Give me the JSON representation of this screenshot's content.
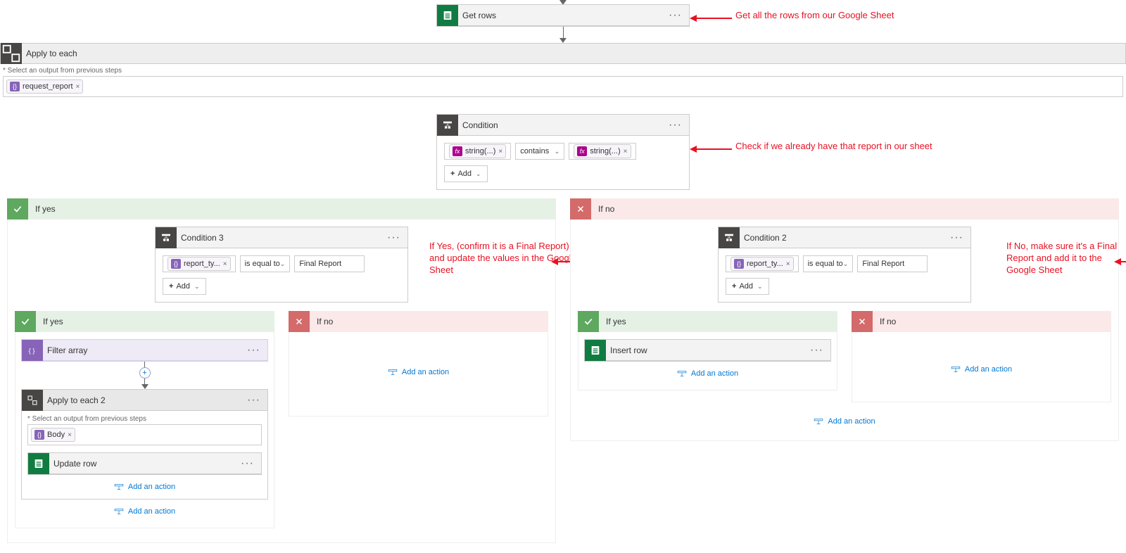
{
  "steps": {
    "getRows": {
      "title": "Get rows"
    },
    "applyEach": {
      "title": "Apply to each",
      "selectLabel": "* Select an output from previous steps",
      "token": "request_report"
    },
    "condition": {
      "title": "Condition",
      "left": "string(...)",
      "op": "contains",
      "right": "string(...)",
      "add": "Add"
    },
    "branches": {
      "yes": "If yes",
      "no": "If no"
    },
    "condition3": {
      "title": "Condition 3",
      "left": "report_ty...",
      "op": "is equal to",
      "right": "Final Report",
      "add": "Add"
    },
    "condition2": {
      "title": "Condition 2",
      "left": "report_ty...",
      "op": "is equal to",
      "right": "Final Report",
      "add": "Add"
    },
    "filterArray": {
      "title": "Filter array"
    },
    "applyEach2": {
      "title": "Apply to each 2",
      "selectLabel": "* Select an output from previous steps",
      "token": "Body"
    },
    "updateRow": {
      "title": "Update row"
    },
    "insertRow": {
      "title": "Insert row"
    },
    "addAction": "Add an action"
  },
  "annotations": {
    "a1": "Get all the rows from our Google Sheet",
    "a2": "Check if we already have that report in our sheet",
    "a3": "If Yes, (confirm it is a Final Report) and update the values in the Google Sheet",
    "a4": "If No, make sure it's a Final Report and add it to the Google Sheet"
  }
}
